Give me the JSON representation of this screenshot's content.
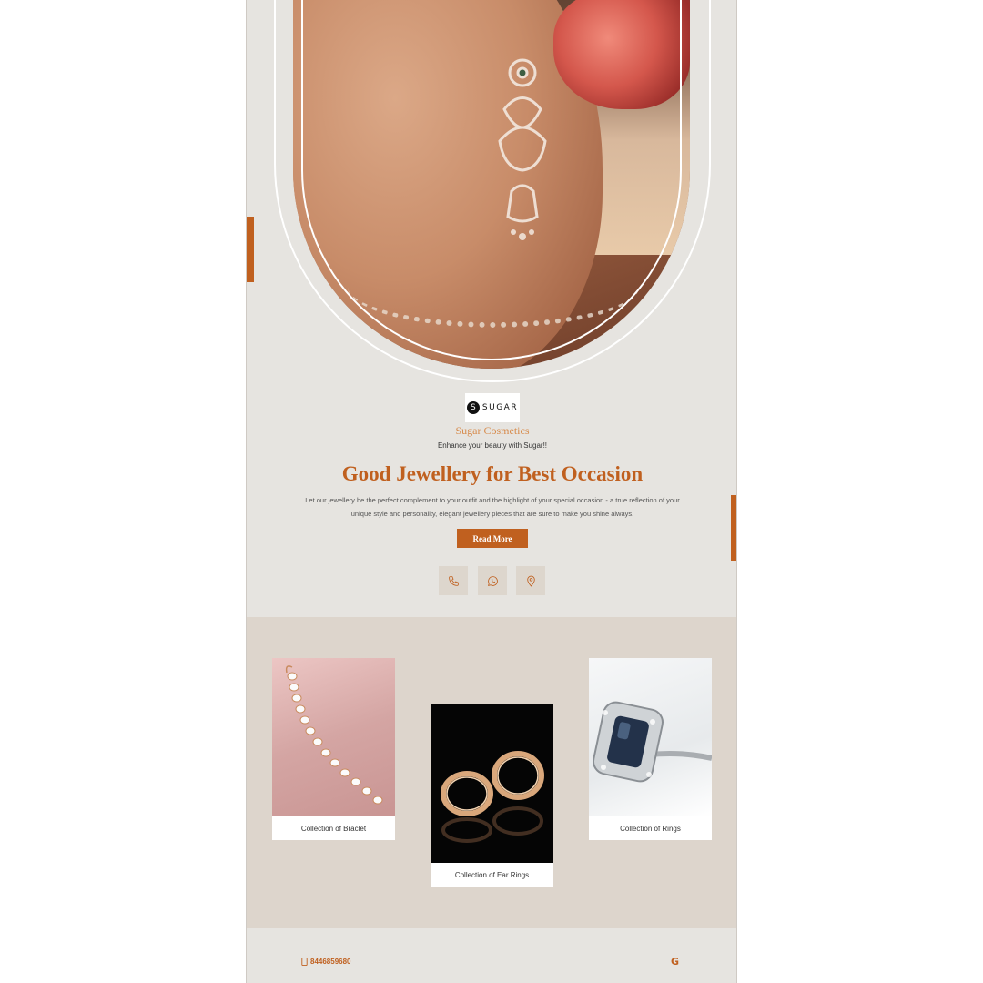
{
  "brand": {
    "logo_mark": "S",
    "logo_text": "SUGAR",
    "name": "Sugar Cosmetics",
    "tagline": "Enhance your beauty with Sugar!!"
  },
  "hero": {
    "headline": "Good Jewellery for Best Occasion",
    "description": "Let our jewellery be the perfect complement to your outfit and the highlight of your special occasion - a true reflection of your unique style and personality, elegant jewellery pieces that are sure to make you shine always.",
    "read_more_label": "Read More"
  },
  "contact_icons": [
    "phone-icon",
    "whatsapp-icon",
    "location-icon"
  ],
  "collections": [
    {
      "caption": "Collection of Braclet"
    },
    {
      "caption": "Collection of Ear Rings"
    },
    {
      "caption": "Collection of Rings"
    }
  ],
  "footer": {
    "phone": "8446859680",
    "google_label": "G"
  },
  "colors": {
    "accent": "#c0601f",
    "brand_name": "#d78a4a",
    "page_bg": "#e6e4e0",
    "collections_bg": "#ddd5cc"
  }
}
